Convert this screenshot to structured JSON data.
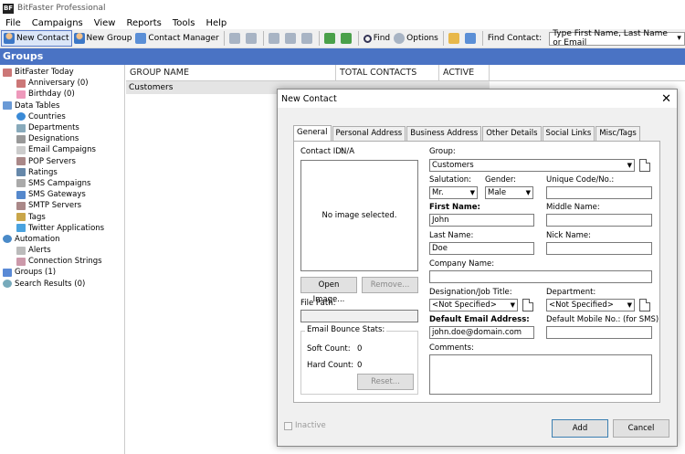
{
  "app": {
    "title": "BitFaster Professional",
    "icon_text": "BF"
  },
  "menu": [
    "File",
    "Campaigns",
    "View",
    "Reports",
    "Tools",
    "Help"
  ],
  "toolbar": {
    "new_contact": "New Contact",
    "new_group": "New Group",
    "contact_manager": "Contact Manager",
    "find": "Find",
    "options": "Options",
    "find_contact_label": "Find Contact:",
    "find_contact_placeholder": "Type First Name, Last Name or Email"
  },
  "groups_title": "Groups",
  "tree": [
    {
      "label": "BitFaster Today",
      "level": 0,
      "icon": "calendar-icon"
    },
    {
      "label": "Anniversary (0)",
      "level": 1,
      "icon": "calendar-icon"
    },
    {
      "label": "Birthday (0)",
      "level": 1,
      "icon": "cake-icon"
    },
    {
      "label": "Data Tables",
      "level": 0,
      "icon": "table-icon"
    },
    {
      "label": "Countries",
      "level": 1,
      "icon": "globe-icon"
    },
    {
      "label": "Departments",
      "level": 1,
      "icon": "department-icon"
    },
    {
      "label": "Designations",
      "level": 1,
      "icon": "designation-icon"
    },
    {
      "label": "Email Campaigns",
      "level": 1,
      "icon": "email-icon"
    },
    {
      "label": "POP Servers",
      "level": 1,
      "icon": "server-icon"
    },
    {
      "label": "Ratings",
      "level": 1,
      "icon": "rating-icon"
    },
    {
      "label": "SMS Campaigns",
      "level": 1,
      "icon": "sms-icon"
    },
    {
      "label": "SMS Gateways",
      "level": 1,
      "icon": "gateway-icon"
    },
    {
      "label": "SMTP Servers",
      "level": 1,
      "icon": "server-icon"
    },
    {
      "label": "Tags",
      "level": 1,
      "icon": "tag-icon"
    },
    {
      "label": "Twitter Applications",
      "level": 1,
      "icon": "twitter-icon"
    },
    {
      "label": "Automation",
      "level": 0,
      "icon": "gear-icon"
    },
    {
      "label": "Alerts",
      "level": 1,
      "icon": "alert-icon"
    },
    {
      "label": "Connection Strings",
      "level": 1,
      "icon": "connection-icon"
    },
    {
      "label": "Groups (1)",
      "level": 0,
      "icon": "group-icon"
    },
    {
      "label": "Search Results (0)",
      "level": 0,
      "icon": "search-icon"
    }
  ],
  "grid": {
    "columns": [
      "GROUP NAME",
      "TOTAL CONTACTS",
      "ACTIVE"
    ],
    "rows": [
      [
        "Customers",
        "",
        ""
      ]
    ]
  },
  "dialog": {
    "title": "New Contact",
    "tabs": [
      "General",
      "Personal Address",
      "Business Address",
      "Other Details",
      "Social Links",
      "Misc/Tags"
    ],
    "contact_id_label": "Contact ID:",
    "contact_id_value": "N/A",
    "no_image": "No image selected.",
    "open_image": "Open Image...",
    "remove": "Remove...",
    "file_path_label": "File Path:",
    "bounce_legend": "Email Bounce Stats:",
    "soft_count_label": "Soft Count:",
    "soft_count_value": "0",
    "hard_count_label": "Hard Count:",
    "hard_count_value": "0",
    "reset": "Reset...",
    "group_label": "Group:",
    "group_value": "Customers",
    "salutation_label": "Salutation:",
    "salutation_value": "Mr.",
    "gender_label": "Gender:",
    "gender_value": "Male",
    "unique_code_label": "Unique Code/No.:",
    "first_name_label": "First Name:",
    "first_name_value": "John",
    "middle_name_label": "Middle Name:",
    "last_name_label": "Last Name:",
    "last_name_value": "Doe",
    "nick_name_label": "Nick Name:",
    "company_label": "Company Name:",
    "designation_label": "Designation/Job Title:",
    "designation_value": "<Not Specified>",
    "department_label": "Department:",
    "department_value": "<Not Specified>",
    "email_label": "Default Email Address:",
    "email_value": "john.doe@domain.com",
    "mobile_label": "Default Mobile No.: (for SMS)",
    "comments_label": "Comments:",
    "inactive_label": "Inactive",
    "add": "Add",
    "cancel": "Cancel"
  }
}
